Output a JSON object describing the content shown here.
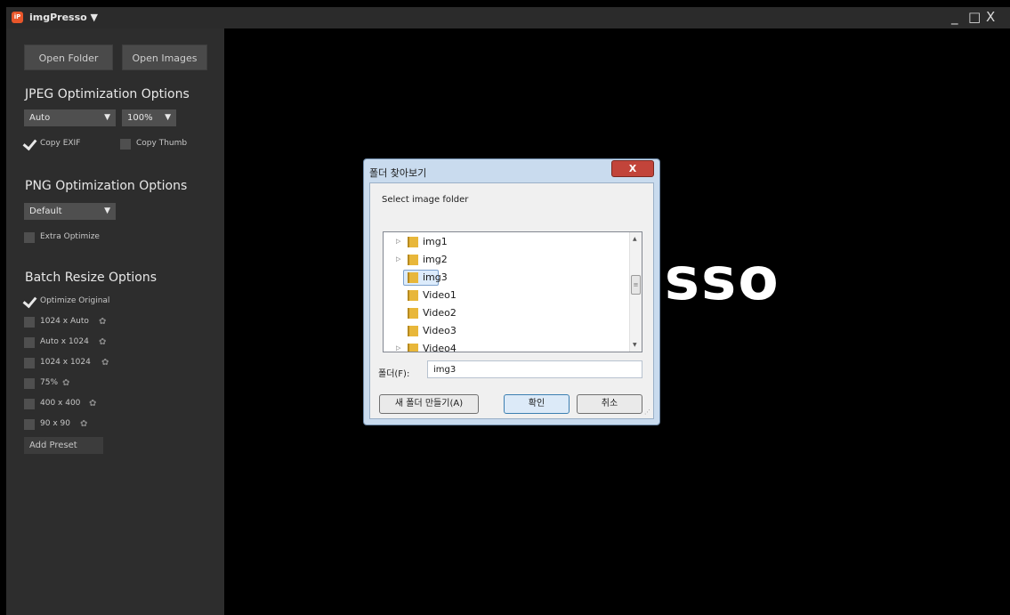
{
  "window": {
    "title": "imgPresso ▼",
    "logo": "iP",
    "minimize": "_",
    "maximize": "□",
    "close": "X"
  },
  "sidebar": {
    "open_folder": "Open Folder",
    "open_images": "Open Images",
    "jpeg": {
      "heading": "JPEG Optimization Options",
      "mode_value": "Auto",
      "quality_value": "100%",
      "copy_exif": {
        "label": "Copy EXIF",
        "checked": true
      },
      "copy_thumb": {
        "label": "Copy Thumb",
        "checked": false
      }
    },
    "png": {
      "heading": "PNG Optimization Options",
      "mode_value": "Default",
      "extra_optimize": {
        "label": "Extra Optimize",
        "checked": false
      }
    },
    "batch": {
      "heading": "Batch Resize Options",
      "optimize_original": {
        "label": "Optimize Original",
        "checked": true
      },
      "presets": [
        {
          "label": "1024 x Auto",
          "checked": false
        },
        {
          "label": "Auto x 1024",
          "checked": false
        },
        {
          "label": "1024 x 1024",
          "checked": false
        },
        {
          "label": "75%",
          "checked": false
        },
        {
          "label": "400 x 400",
          "checked": false
        },
        {
          "label": "90 x 90",
          "checked": false
        }
      ],
      "add_preset": "Add Preset"
    }
  },
  "background_logo": "esso",
  "dialog": {
    "title": "폴더 찾아보기",
    "close": "X",
    "description": "Select image folder",
    "tree": [
      {
        "label": "img1",
        "expandable": true,
        "selected": false
      },
      {
        "label": "img2",
        "expandable": true,
        "selected": false
      },
      {
        "label": "img3",
        "expandable": false,
        "selected": true
      },
      {
        "label": "Video1",
        "expandable": false,
        "selected": false
      },
      {
        "label": "Video2",
        "expandable": false,
        "selected": false
      },
      {
        "label": "Video3",
        "expandable": false,
        "selected": false
      },
      {
        "label": "Video4",
        "expandable": true,
        "selected": false
      }
    ],
    "folder_label": "폴더(F):",
    "folder_value": "img3",
    "new_folder_button": "새 폴더 만들기(A)",
    "ok_button": "확인",
    "cancel_button": "취소"
  },
  "colors": {
    "sidebar_bg": "#2d2d2d",
    "titlebar_bg": "#2b2b2b",
    "main_bg": "#000000",
    "dialog_frame": "#c9dbee",
    "close_red": "#c2443a"
  }
}
